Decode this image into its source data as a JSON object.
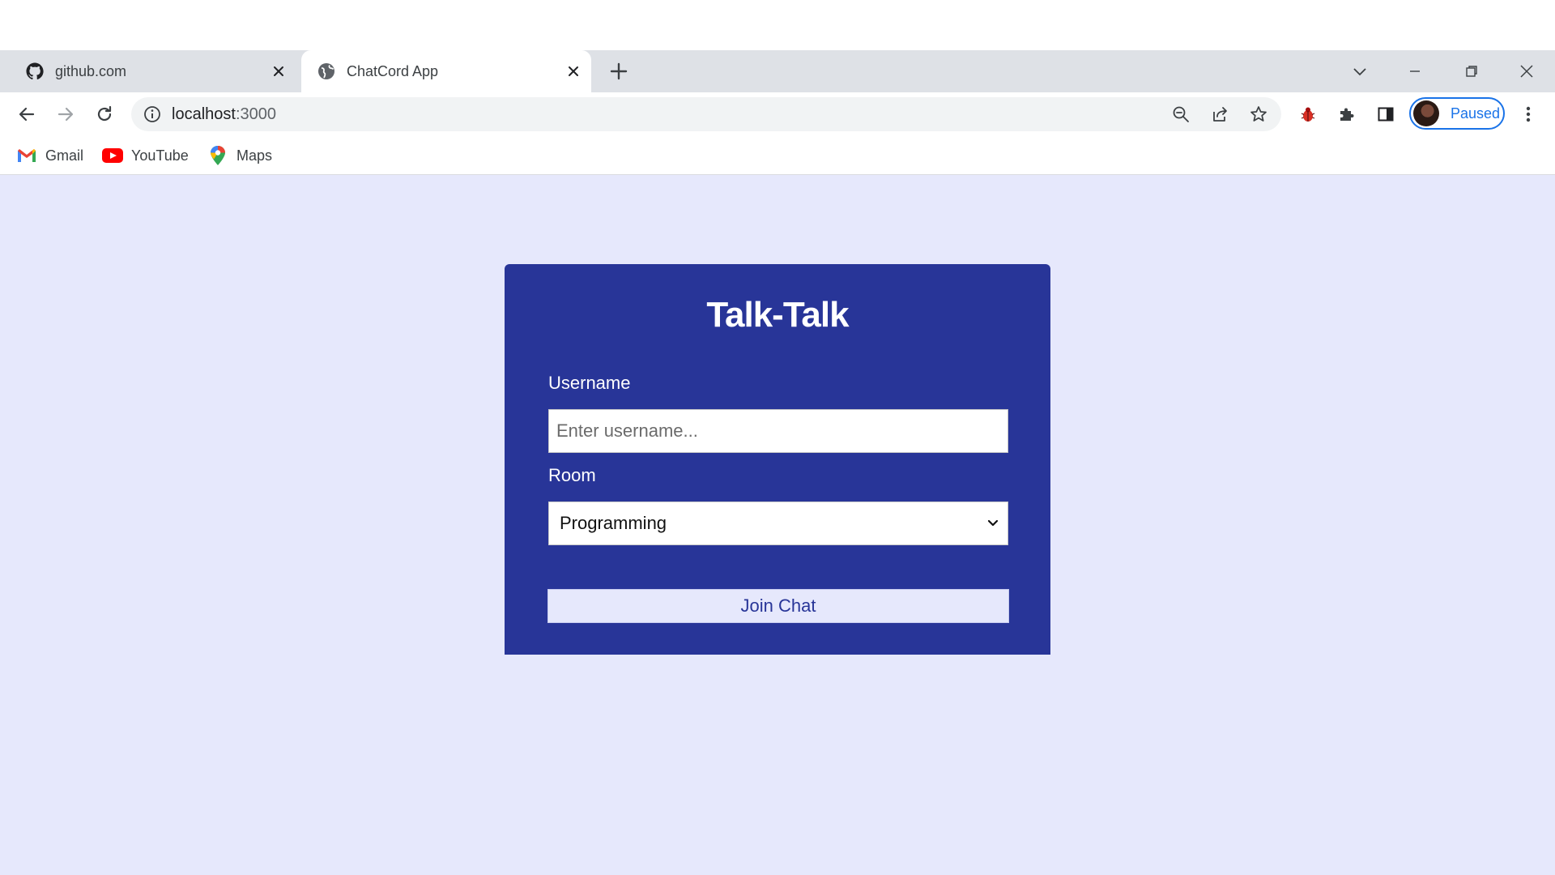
{
  "browser": {
    "tabs": [
      {
        "title": "github.com",
        "icon": "github-icon",
        "active": false
      },
      {
        "title": "ChatCord App",
        "icon": "globe-icon",
        "active": true
      }
    ],
    "address": {
      "host": "localhost",
      "port": ":3000"
    },
    "profile_label": "Paused",
    "bookmarks": [
      {
        "label": "Gmail",
        "icon": "gmail-icon"
      },
      {
        "label": "YouTube",
        "icon": "youtube-icon"
      },
      {
        "label": "Maps",
        "icon": "maps-icon"
      }
    ]
  },
  "app": {
    "title": "Talk-Talk",
    "username": {
      "label": "Username",
      "placeholder": "Enter username...",
      "value": ""
    },
    "room": {
      "label": "Room",
      "selected": "Programming"
    },
    "join_label": "Join Chat"
  },
  "colors": {
    "page_background": "#e6e8fc",
    "card_background": "#283598",
    "accent": "#1a73e8"
  }
}
